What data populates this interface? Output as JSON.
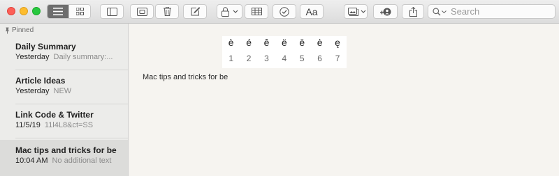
{
  "toolbar": {
    "view_modes": [
      {
        "icon": "list-view-icon",
        "active": true
      },
      {
        "icon": "gallery-view-icon",
        "active": false
      }
    ],
    "buttons": [
      {
        "icon": "sidebar-toggle-icon"
      },
      {
        "icon": "attachments-icon"
      },
      {
        "icon": "trash-icon"
      },
      {
        "icon": "compose-icon"
      },
      {
        "icon": "lock-icon"
      },
      {
        "icon": "table-icon"
      },
      {
        "icon": "checklist-icon"
      },
      {
        "icon": "format-icon",
        "label": "Aa"
      },
      {
        "icon": "media-icon"
      },
      {
        "icon": "collaborate-icon"
      },
      {
        "icon": "share-icon"
      }
    ],
    "search": {
      "placeholder": "Search",
      "value": ""
    }
  },
  "sidebar": {
    "pinned_label": "Pinned",
    "notes": [
      {
        "title": "Daily Summary",
        "date": "Yesterday",
        "preview": "Daily summary:...",
        "selected": false
      },
      {
        "title": "Article Ideas",
        "date": "Yesterday",
        "preview": "NEW",
        "selected": false
      },
      {
        "title": "Link Code & Twitter",
        "date": "11/5/19",
        "preview": "11l4L8&ct=SS",
        "selected": false
      },
      {
        "title": "Mac tips and tricks for be",
        "date": "10:04 AM",
        "preview": "No additional text",
        "selected": true
      }
    ]
  },
  "editor": {
    "accent_chars": [
      "è",
      "é",
      "ê",
      "ë",
      "ē",
      "ė",
      "ę"
    ],
    "accent_numbers": [
      "1",
      "2",
      "3",
      "4",
      "5",
      "6",
      "7"
    ],
    "body": "Mac tips and tricks for be"
  }
}
